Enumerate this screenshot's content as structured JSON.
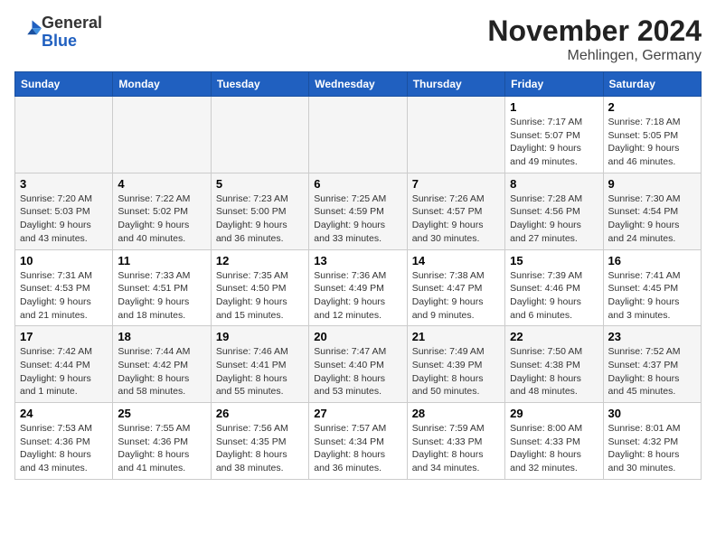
{
  "header": {
    "logo_line1": "General",
    "logo_line2": "Blue",
    "month": "November 2024",
    "location": "Mehlingen, Germany"
  },
  "weekdays": [
    "Sunday",
    "Monday",
    "Tuesday",
    "Wednesday",
    "Thursday",
    "Friday",
    "Saturday"
  ],
  "weeks": [
    [
      {
        "day": "",
        "info": ""
      },
      {
        "day": "",
        "info": ""
      },
      {
        "day": "",
        "info": ""
      },
      {
        "day": "",
        "info": ""
      },
      {
        "day": "",
        "info": ""
      },
      {
        "day": "1",
        "info": "Sunrise: 7:17 AM\nSunset: 5:07 PM\nDaylight: 9 hours\nand 49 minutes."
      },
      {
        "day": "2",
        "info": "Sunrise: 7:18 AM\nSunset: 5:05 PM\nDaylight: 9 hours\nand 46 minutes."
      }
    ],
    [
      {
        "day": "3",
        "info": "Sunrise: 7:20 AM\nSunset: 5:03 PM\nDaylight: 9 hours\nand 43 minutes."
      },
      {
        "day": "4",
        "info": "Sunrise: 7:22 AM\nSunset: 5:02 PM\nDaylight: 9 hours\nand 40 minutes."
      },
      {
        "day": "5",
        "info": "Sunrise: 7:23 AM\nSunset: 5:00 PM\nDaylight: 9 hours\nand 36 minutes."
      },
      {
        "day": "6",
        "info": "Sunrise: 7:25 AM\nSunset: 4:59 PM\nDaylight: 9 hours\nand 33 minutes."
      },
      {
        "day": "7",
        "info": "Sunrise: 7:26 AM\nSunset: 4:57 PM\nDaylight: 9 hours\nand 30 minutes."
      },
      {
        "day": "8",
        "info": "Sunrise: 7:28 AM\nSunset: 4:56 PM\nDaylight: 9 hours\nand 27 minutes."
      },
      {
        "day": "9",
        "info": "Sunrise: 7:30 AM\nSunset: 4:54 PM\nDaylight: 9 hours\nand 24 minutes."
      }
    ],
    [
      {
        "day": "10",
        "info": "Sunrise: 7:31 AM\nSunset: 4:53 PM\nDaylight: 9 hours\nand 21 minutes."
      },
      {
        "day": "11",
        "info": "Sunrise: 7:33 AM\nSunset: 4:51 PM\nDaylight: 9 hours\nand 18 minutes."
      },
      {
        "day": "12",
        "info": "Sunrise: 7:35 AM\nSunset: 4:50 PM\nDaylight: 9 hours\nand 15 minutes."
      },
      {
        "day": "13",
        "info": "Sunrise: 7:36 AM\nSunset: 4:49 PM\nDaylight: 9 hours\nand 12 minutes."
      },
      {
        "day": "14",
        "info": "Sunrise: 7:38 AM\nSunset: 4:47 PM\nDaylight: 9 hours\nand 9 minutes."
      },
      {
        "day": "15",
        "info": "Sunrise: 7:39 AM\nSunset: 4:46 PM\nDaylight: 9 hours\nand 6 minutes."
      },
      {
        "day": "16",
        "info": "Sunrise: 7:41 AM\nSunset: 4:45 PM\nDaylight: 9 hours\nand 3 minutes."
      }
    ],
    [
      {
        "day": "17",
        "info": "Sunrise: 7:42 AM\nSunset: 4:44 PM\nDaylight: 9 hours\nand 1 minute."
      },
      {
        "day": "18",
        "info": "Sunrise: 7:44 AM\nSunset: 4:42 PM\nDaylight: 8 hours\nand 58 minutes."
      },
      {
        "day": "19",
        "info": "Sunrise: 7:46 AM\nSunset: 4:41 PM\nDaylight: 8 hours\nand 55 minutes."
      },
      {
        "day": "20",
        "info": "Sunrise: 7:47 AM\nSunset: 4:40 PM\nDaylight: 8 hours\nand 53 minutes."
      },
      {
        "day": "21",
        "info": "Sunrise: 7:49 AM\nSunset: 4:39 PM\nDaylight: 8 hours\nand 50 minutes."
      },
      {
        "day": "22",
        "info": "Sunrise: 7:50 AM\nSunset: 4:38 PM\nDaylight: 8 hours\nand 48 minutes."
      },
      {
        "day": "23",
        "info": "Sunrise: 7:52 AM\nSunset: 4:37 PM\nDaylight: 8 hours\nand 45 minutes."
      }
    ],
    [
      {
        "day": "24",
        "info": "Sunrise: 7:53 AM\nSunset: 4:36 PM\nDaylight: 8 hours\nand 43 minutes."
      },
      {
        "day": "25",
        "info": "Sunrise: 7:55 AM\nSunset: 4:36 PM\nDaylight: 8 hours\nand 41 minutes."
      },
      {
        "day": "26",
        "info": "Sunrise: 7:56 AM\nSunset: 4:35 PM\nDaylight: 8 hours\nand 38 minutes."
      },
      {
        "day": "27",
        "info": "Sunrise: 7:57 AM\nSunset: 4:34 PM\nDaylight: 8 hours\nand 36 minutes."
      },
      {
        "day": "28",
        "info": "Sunrise: 7:59 AM\nSunset: 4:33 PM\nDaylight: 8 hours\nand 34 minutes."
      },
      {
        "day": "29",
        "info": "Sunrise: 8:00 AM\nSunset: 4:33 PM\nDaylight: 8 hours\nand 32 minutes."
      },
      {
        "day": "30",
        "info": "Sunrise: 8:01 AM\nSunset: 4:32 PM\nDaylight: 8 hours\nand 30 minutes."
      }
    ]
  ]
}
